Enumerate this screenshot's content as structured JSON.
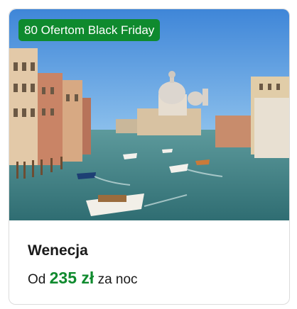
{
  "card": {
    "badge": "80 Ofertom Black Friday",
    "image_alt": "Wenecja - Canal Grande",
    "title": "Wenecja",
    "price_prefix": "Od",
    "price_value": "235 zł",
    "price_suffix": "za noc"
  },
  "colors": {
    "accent": "#0f8a2e",
    "sky": "#4a8fd6",
    "water": "#3a7a7e"
  }
}
